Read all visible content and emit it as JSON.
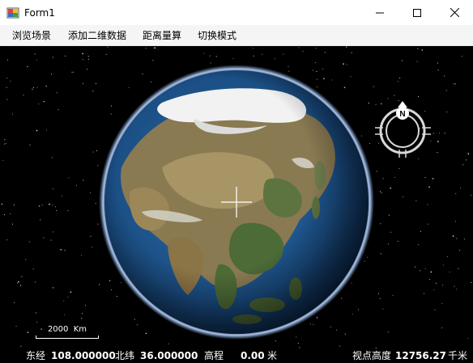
{
  "window": {
    "title": "Form1",
    "icons": {
      "app": "winforms-app-icon",
      "minimize": "minimize-icon",
      "maximize": "maximize-icon",
      "close": "close-icon"
    }
  },
  "menu": {
    "items": [
      {
        "label": "浏览场景"
      },
      {
        "label": "添加二维数据"
      },
      {
        "label": "距离量算"
      },
      {
        "label": "切换模式"
      }
    ]
  },
  "scene": {
    "globe_icon": "earth-globe",
    "crosshair_icon": "crosshair-icon",
    "compass": {
      "icon": "compass-icon",
      "north_label": "N"
    },
    "scale": {
      "label": "2000  Km"
    }
  },
  "status": {
    "lon_label": "东经",
    "lon_value": "108.000000",
    "lat_label": "北纬",
    "lat_value": "36.000000",
    "elev_label": "高程",
    "elev_value": "0.00",
    "elev_unit": "米",
    "view_label": "视点高度",
    "view_value": "12756.27",
    "view_unit": "千米"
  },
  "colors": {
    "background": "#000000",
    "ocean": "#1d4f86",
    "land": "#8a7a52",
    "snow": "#f2f2f2"
  }
}
